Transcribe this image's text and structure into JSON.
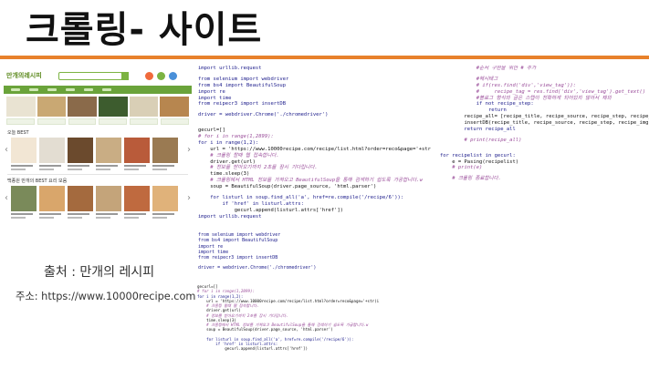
{
  "slide": {
    "title": "크롤링- 사이트",
    "accent_color": "#e8812b"
  },
  "website": {
    "logo": "만개의레시피",
    "section1_title": "오늘 BEST",
    "section2_title": "백종원 만개의 BEST 요리 모음",
    "brand_color": "#6aa33a",
    "source_caption": "출처 : 만개의 레시피",
    "address": "주소: https://www.10000recipe.com"
  },
  "code": {
    "panel1": [
      "import urllib.request",
      "",
      "from selenium import webdriver",
      "from bs4 import BeautifulSoup",
      "import re",
      "import time",
      "from reipecr3 import insertDB",
      "",
      "driver = webdriver.Chrome('./chromedriver')",
      "",
      "",
      "gecurl=[]",
      "# for i in range(1,2899):",
      "for i in range(1,2):",
      "    url = 'https://www.10000recipe.com/recipe/list.html?order=reco&page='+str(i)",
      "    # 크롤링 할때 웹 접속합니다.",
      "    driver.get(url)",
      "    # 정보를 받아오기까지 2초를 잠시 기다립니다.",
      "    time.sleep(3)",
      "    # 크롤링에서 HTML 정보를 가져오고 BeautifulSoup을 통해 검색하기 쉽도록 가공합니다.w",
      "    soup = BeautifulSoup(driver.page_source, 'html.parser')",
      "",
      "    for listurl in soup.find_all('a', href=re.compile('/recipe/6')):",
      "        if 'href' in listurl.attrs:",
      "            gecurl.append(listurl.attrs['href'])",
      "import urllib.request"
    ],
    "panel2": [
      "from selenium import webdriver",
      "from bs4 import BeautifulSoup",
      "import re",
      "import time",
      "from reipecr3 import insertDB",
      "",
      "driver = webdriver.Chrome('./chromedriver')"
    ],
    "panel3": [
      "gecurl=[]",
      "# for i in range(1,2899):",
      "for i in range(1,2):",
      "    url = 'https://www.10000recipe.com/recipe/list.html?order=reco&page='+str(i)",
      "    # 크롤링 할때 웹 접속합니다.",
      "    driver.get(url)",
      "    # 정보를 받아오기까지 2초를 잠시 기다립니다.",
      "    time.sleep(3)",
      "    # 크롤링에서 HTML 정보를 가져오고 BeautifulSoup을 통해 검색하기 쉽도록 가공합니다.w",
      "    soup = BeautifulSoup(driver.page_source, 'html.parser')",
      "",
      "    for listurl in soup.find_all('a', href=re.compile('/recipe/6')):",
      "        if 'href' in listurl.attrs:",
      "            gecurl.append(listurl.attrs['href'])"
    ],
    "panel4": [
      "            #순서 구현을 위한 # 추가",
      "",
      "            #해시태그",
      "            # if(res.find('div','view_tag')):",
      "            #     recipe_tag = res.find('div','view_tag').get_text()",
      "            #블로그 형식의 글은 스텝이 정확하게 되어있지 않아서 제외",
      "            if not recipe_step:",
      "                return",
      "        recipe_all= [recipe_title, recipe_source, recipe_step, recipe_img]",
      "        insertDB(recipe_title, recipe_source, recipe_step, recipe_img)",
      "        return recipe_all",
      "",
      "        # print(recipe_all)",
      "",
      "",
      "for recipelist in gecurl:",
      "    e = Pasing(recipelist)",
      "    # print(e)",
      "",
      "    # 크롤링 종료합니다.",
      "",
      "driver.quit()"
    ]
  }
}
